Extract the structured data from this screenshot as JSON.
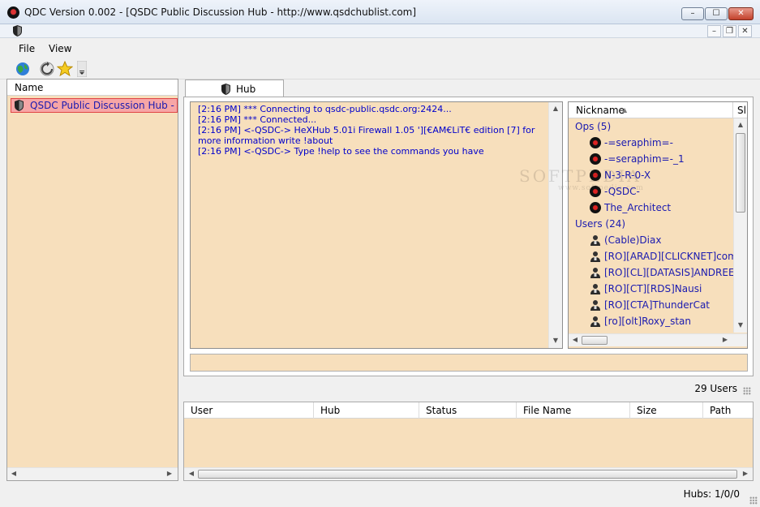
{
  "window": {
    "title": "QDC Version 0.002 - [QSDC Public Discussion Hub - http://www.qsdchublist.com]",
    "minimize": "–",
    "maximize": "☐",
    "close": "✕",
    "mdi_minimize": "–",
    "mdi_restore": "❐",
    "mdi_close": "✕"
  },
  "menu": {
    "items": [
      "File",
      "View"
    ]
  },
  "toolbar": {
    "buttons": [
      "globe-icon",
      "refresh-icon",
      "star-icon",
      "dropdown-chevron-icon"
    ]
  },
  "hub_list": {
    "column_name": "Name",
    "items": [
      {
        "label": "QSDC Public Discussion Hub - http://www.qsdchublist.com",
        "selected": true
      }
    ]
  },
  "tabs": [
    {
      "label": "Hub",
      "active": true
    }
  ],
  "chat": {
    "lines": [
      "[2:16 PM] *** Connecting to qsdc-public.qsdc.org:2424...",
      "[2:16 PM] *** Connected...",
      "[2:16 PM] <-QSDC-> HeXHub 5.01i Firewall 1.05 '][€AM€LiT€ edition [7] for more information write !about",
      "[2:16 PM] <-QSDC-> Type !help to see the commands you have"
    ]
  },
  "user_list": {
    "column_nickname": "Nickname",
    "column_share": "Sl",
    "groups": [
      {
        "label": "Ops (5)",
        "users": [
          "-=seraphim=-",
          "-=seraphim=-_1",
          "N-3-R-0-X",
          "-QSDC-",
          "The_Architect"
        ]
      },
      {
        "label": "Users (24)",
        "users": [
          "(Cable)Diax",
          "[RO][ARAD][CLICKNET]com...",
          "[RO][CL][DATASIS]ANDREEA",
          "[RO][CT][RDS]Nausi",
          "[RO][CTA]ThunderCat",
          "[ro][olt]Roxy_stan"
        ]
      }
    ]
  },
  "status": {
    "user_count": "29 Users",
    "hubs": "Hubs: 1/0/0"
  },
  "transfers": {
    "columns": [
      "User",
      "Hub",
      "Status",
      "File Name",
      "Size",
      "Path"
    ]
  },
  "watermark": {
    "main": "SOFTPEDIA",
    "sub": "www.softpedia.com"
  },
  "colors": {
    "panel_bg": "#f7dfbc",
    "link_blue": "#1a1ab0",
    "chat_blue": "#0000cc",
    "selection": "#f7a6a6"
  }
}
